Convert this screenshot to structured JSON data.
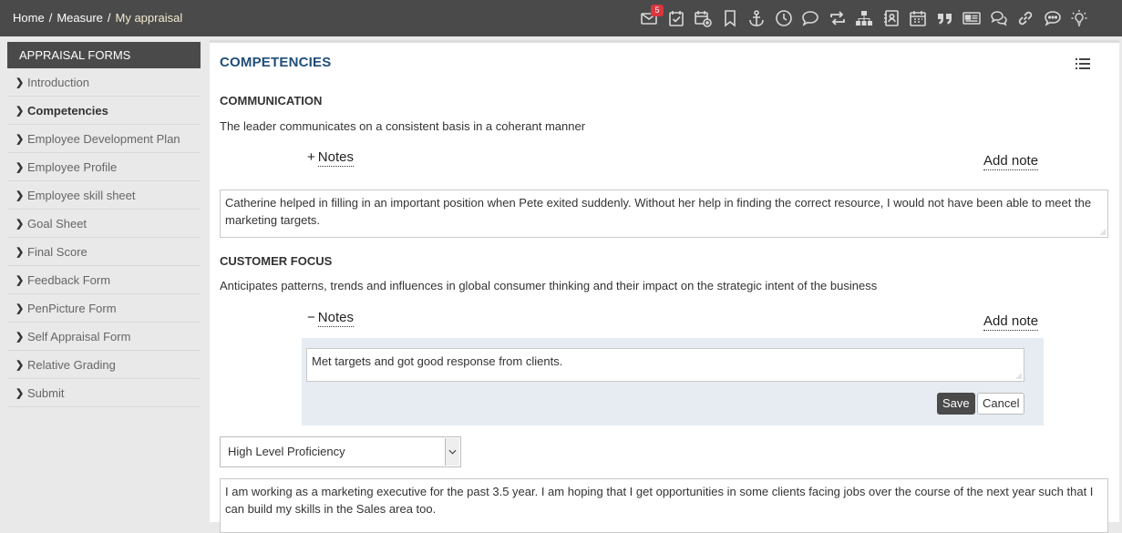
{
  "breadcrumb": {
    "home": "Home",
    "measure": "Measure",
    "current": "My appraisal",
    "separator": "/"
  },
  "toolbar": {
    "icons": [
      "mail-icon",
      "task-check-icon",
      "calendar-add-icon",
      "bookmark-icon",
      "anchor-icon",
      "clock-icon",
      "chat-bubble-icon",
      "repeat-icon",
      "org-chart-icon",
      "contact-card-icon",
      "calendar-icon",
      "quote-icon",
      "newspaper-icon",
      "discussion-icon",
      "link-icon",
      "comment-dots-icon",
      "lightbulb-icon"
    ],
    "mail_badge": "5"
  },
  "sidebar": {
    "header": "APPRAISAL FORMS",
    "items": [
      {
        "label": "Introduction"
      },
      {
        "label": "Competencies"
      },
      {
        "label": "Employee Development Plan"
      },
      {
        "label": "Employee Profile"
      },
      {
        "label": "Employee skill sheet"
      },
      {
        "label": "Goal Sheet"
      },
      {
        "label": "Final Score"
      },
      {
        "label": "Feedback Form"
      },
      {
        "label": "PenPicture Form"
      },
      {
        "label": "Self Appraisal Form"
      },
      {
        "label": "Relative Grading"
      },
      {
        "label": "Submit"
      }
    ],
    "active_item": "Competencies"
  },
  "main": {
    "title": "COMPETENCIES",
    "communication": {
      "title": "COMMUNICATION",
      "description": "The leader communicates on a consistent basis in a coherant manner",
      "notes_toggle_symbol": "+",
      "notes_label": "Notes",
      "add_note_label": "Add note",
      "comment": "Catherine helped in filling in an important position when Pete exited suddenly. Without her help in finding the correct resource, I would not have been able to meet the marketing targets."
    },
    "customer_focus": {
      "title": "CUSTOMER FOCUS",
      "description": "Anticipates patterns, trends and influences in global consumer thinking and their impact on the strategic intent of the business",
      "notes_toggle_symbol": "−",
      "notes_label": "Notes",
      "add_note_label": "Add note",
      "note_value": "Met targets and got good response from clients.",
      "save_label": "Save",
      "cancel_label": "Cancel",
      "proficiency_selected": "High Level Proficiency",
      "comment": "I am working as a marketing executive for the past 3.5 year. I am hoping that I get opportunities in some clients facing jobs over the course of the next year such that I can build my skills in the Sales area too."
    }
  }
}
